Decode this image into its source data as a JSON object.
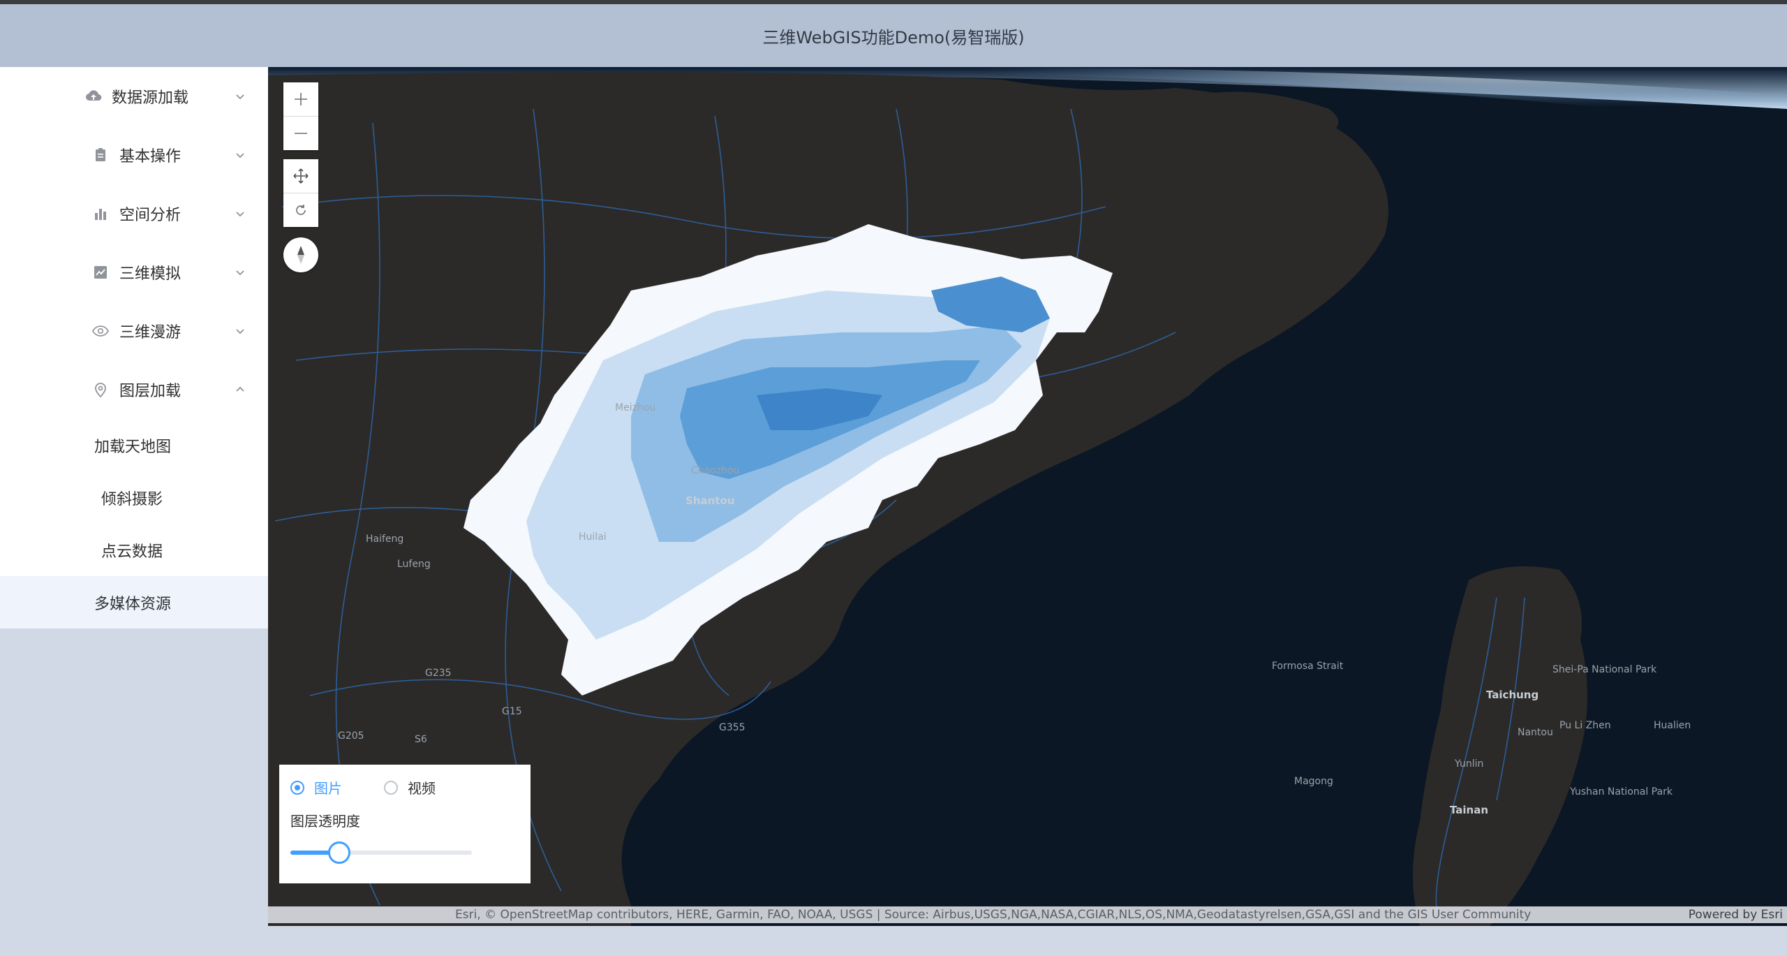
{
  "header": {
    "title": "三维WebGIS功能Demo(易智瑞版)"
  },
  "sidebar": {
    "items": [
      {
        "label": "数据源加载",
        "icon": "cloud-upload-icon",
        "expanded": false
      },
      {
        "label": "基本操作",
        "icon": "clipboard-icon",
        "expanded": false
      },
      {
        "label": "空间分析",
        "icon": "bar-chart-icon",
        "expanded": false
      },
      {
        "label": "三维模拟",
        "icon": "line-chart-icon",
        "expanded": false
      },
      {
        "label": "三维漫游",
        "icon": "eye-icon",
        "expanded": false
      },
      {
        "label": "图层加载",
        "icon": "location-pin-icon",
        "expanded": true
      }
    ],
    "subitems": [
      {
        "label": "加载天地图",
        "active": false
      },
      {
        "label": "倾斜摄影",
        "active": false
      },
      {
        "label": "点云数据",
        "active": false
      },
      {
        "label": "多媒体资源",
        "active": true
      }
    ]
  },
  "map": {
    "labels": [
      "Shantou",
      "Chaozhou",
      "Meizhou",
      "Huilai",
      "Lufeng",
      "Haifeng",
      "Taichung",
      "Yunlin",
      "Tainan",
      "Nantou",
      "Hualien",
      "Magong",
      "Formosa Strait",
      "Pu Li Zhen",
      "Yushan National Park",
      "Shei-Pa National Park",
      "G205",
      "G235",
      "G15",
      "G355",
      "S6"
    ]
  },
  "media_panel": {
    "options": [
      {
        "label": "图片",
        "checked": true
      },
      {
        "label": "视频",
        "checked": false
      }
    ],
    "opacity_label": "图层透明度",
    "opacity_value": 0.27
  },
  "attribution": {
    "source": "Esri, © OpenStreetMap contributors, HERE, Garmin, FAO, NOAA, USGS | Source: Airbus,USGS,NGA,NASA,CGIAR,NLS,OS,NMA,Geodatastyrelsen,GSA,GSI and the GIS User Community",
    "powered": "Powered by Esri"
  },
  "colors": {
    "header_bg": "#b3c0d3",
    "accent": "#409eff",
    "land": "#2b2a29",
    "ocean": "#0b1724",
    "roads": "#2f6fb5"
  }
}
